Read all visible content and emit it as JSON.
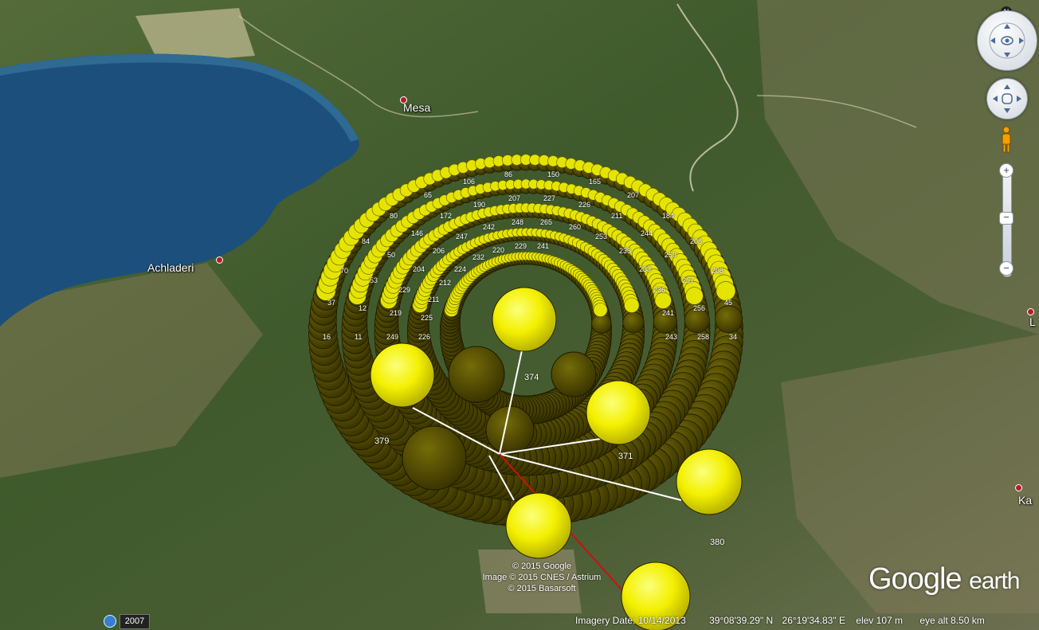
{
  "map": {
    "places": [
      {
        "name": "Mesa"
      },
      {
        "name": "Achladeri"
      },
      {
        "name": "L"
      },
      {
        "name": "Ka"
      }
    ],
    "ring_labels": [
      "374",
      "371",
      "379",
      "380"
    ],
    "dense_labels": [
      "16",
      "37",
      "70",
      "84",
      "80",
      "65",
      "106",
      "86",
      "150",
      "165",
      "207",
      "184",
      "208",
      "208",
      "45",
      "34",
      "11",
      "12",
      "53",
      "50",
      "146",
      "172",
      "190",
      "207",
      "227",
      "226",
      "211",
      "244",
      "259",
      "257",
      "256",
      "258",
      "249",
      "219",
      "229",
      "204",
      "206",
      "247",
      "242",
      "248",
      "265",
      "260",
      "253",
      "235",
      "233",
      "236",
      "241",
      "243",
      "226",
      "225",
      "211",
      "212",
      "224",
      "232",
      "220",
      "229",
      "241"
    ],
    "colors": {
      "marker": "#f4f000",
      "marker_dark": "#4d4700",
      "line_white": "#ffffff",
      "line_red": "#cc1111"
    }
  },
  "copyright": {
    "line1": "© 2015 Google",
    "line2": "Image © 2015 CNES / Astrium",
    "line3": "© 2015 Basarsoft"
  },
  "logo": {
    "google": "Google",
    "earth": "earth"
  },
  "status": {
    "imagery_date": "Imagery Date: 10/14/2013",
    "lat": "39°08'39.29\" N",
    "lon": "26°19'34.83\" E",
    "elev": "elev   107 m",
    "eye_alt": "eye alt   8.50 km",
    "year": "2007"
  },
  "nav": {
    "north": "N",
    "zoom_in": "+",
    "zoom_out": "−",
    "icons": [
      "look-icon",
      "move-icon",
      "pegman-icon",
      "zoom-in-icon",
      "zoom-out-icon",
      "north-icon",
      "history-icon"
    ]
  }
}
